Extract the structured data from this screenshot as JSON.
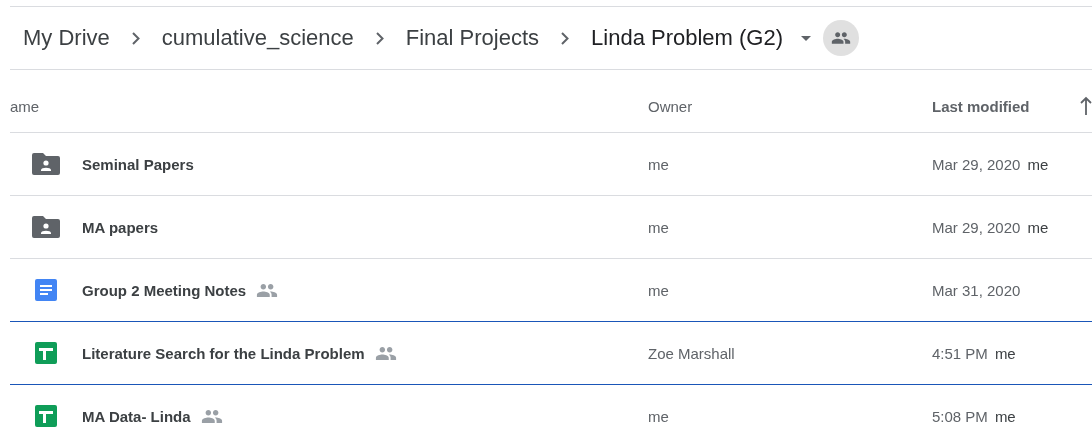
{
  "breadcrumb": {
    "items": [
      {
        "label": "My Drive"
      },
      {
        "label": "cumulative_science"
      },
      {
        "label": "Final Projects"
      },
      {
        "label": "Linda Problem (G2)"
      }
    ],
    "shared": true
  },
  "table": {
    "columns": [
      {
        "label": "ame"
      },
      {
        "label": "Owner"
      },
      {
        "label": "Last modified"
      }
    ],
    "rows": [
      {
        "kind": "folder",
        "name": "Seminal Papers",
        "shared": false,
        "focused": false,
        "owner": "me",
        "modified": "Mar 29, 2020",
        "modified_by": "me"
      },
      {
        "kind": "folder",
        "name": "MA papers",
        "shared": false,
        "focused": false,
        "owner": "me",
        "modified": "Mar 29, 2020",
        "modified_by": "me"
      },
      {
        "kind": "doc",
        "name": "Group 2 Meeting Notes",
        "shared": true,
        "focused": false,
        "owner": "me",
        "modified": "Mar 31, 2020"
      },
      {
        "kind": "sheet",
        "name": "Literature Search for the Linda Problem",
        "shared": true,
        "focused": true,
        "owner": "Zoe Marshall",
        "modified": "4:51 PM",
        "modified_by": "me"
      },
      {
        "kind": "sheet",
        "name": "MA Data- Linda",
        "shared": true,
        "focused": false,
        "owner": "me",
        "modified": "5:08 PM",
        "modified_by": "me"
      }
    ]
  }
}
